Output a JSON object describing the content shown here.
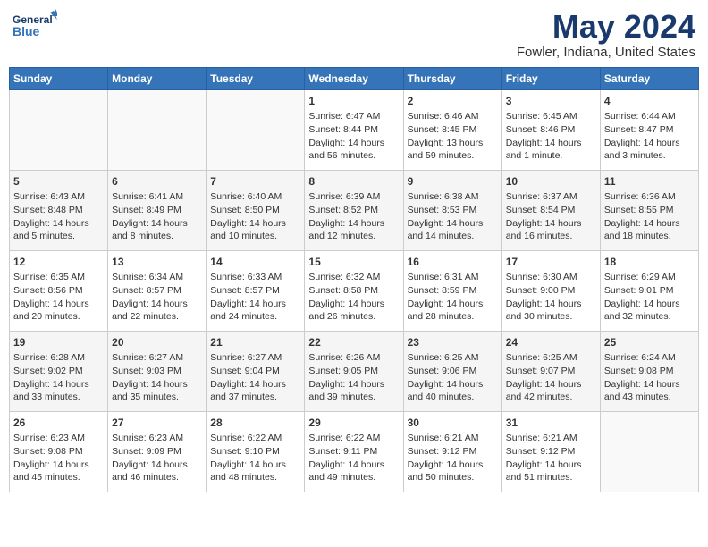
{
  "header": {
    "logo_line1": "General",
    "logo_line2": "Blue",
    "main_title": "May 2024",
    "subtitle": "Fowler, Indiana, United States"
  },
  "days_of_week": [
    "Sunday",
    "Monday",
    "Tuesday",
    "Wednesday",
    "Thursday",
    "Friday",
    "Saturday"
  ],
  "weeks": [
    [
      {
        "day": "",
        "content": ""
      },
      {
        "day": "",
        "content": ""
      },
      {
        "day": "",
        "content": ""
      },
      {
        "day": "1",
        "content": "Sunrise: 6:47 AM\nSunset: 8:44 PM\nDaylight: 14 hours\nand 56 minutes."
      },
      {
        "day": "2",
        "content": "Sunrise: 6:46 AM\nSunset: 8:45 PM\nDaylight: 13 hours\nand 59 minutes."
      },
      {
        "day": "3",
        "content": "Sunrise: 6:45 AM\nSunset: 8:46 PM\nDaylight: 14 hours\nand 1 minute."
      },
      {
        "day": "4",
        "content": "Sunrise: 6:44 AM\nSunset: 8:47 PM\nDaylight: 14 hours\nand 3 minutes."
      }
    ],
    [
      {
        "day": "5",
        "content": "Sunrise: 6:43 AM\nSunset: 8:48 PM\nDaylight: 14 hours\nand 5 minutes."
      },
      {
        "day": "6",
        "content": "Sunrise: 6:41 AM\nSunset: 8:49 PM\nDaylight: 14 hours\nand 8 minutes."
      },
      {
        "day": "7",
        "content": "Sunrise: 6:40 AM\nSunset: 8:50 PM\nDaylight: 14 hours\nand 10 minutes."
      },
      {
        "day": "8",
        "content": "Sunrise: 6:39 AM\nSunset: 8:52 PM\nDaylight: 14 hours\nand 12 minutes."
      },
      {
        "day": "9",
        "content": "Sunrise: 6:38 AM\nSunset: 8:53 PM\nDaylight: 14 hours\nand 14 minutes."
      },
      {
        "day": "10",
        "content": "Sunrise: 6:37 AM\nSunset: 8:54 PM\nDaylight: 14 hours\nand 16 minutes."
      },
      {
        "day": "11",
        "content": "Sunrise: 6:36 AM\nSunset: 8:55 PM\nDaylight: 14 hours\nand 18 minutes."
      }
    ],
    [
      {
        "day": "12",
        "content": "Sunrise: 6:35 AM\nSunset: 8:56 PM\nDaylight: 14 hours\nand 20 minutes."
      },
      {
        "day": "13",
        "content": "Sunrise: 6:34 AM\nSunset: 8:57 PM\nDaylight: 14 hours\nand 22 minutes."
      },
      {
        "day": "14",
        "content": "Sunrise: 6:33 AM\nSunset: 8:57 PM\nDaylight: 14 hours\nand 24 minutes."
      },
      {
        "day": "15",
        "content": "Sunrise: 6:32 AM\nSunset: 8:58 PM\nDaylight: 14 hours\nand 26 minutes."
      },
      {
        "day": "16",
        "content": "Sunrise: 6:31 AM\nSunset: 8:59 PM\nDaylight: 14 hours\nand 28 minutes."
      },
      {
        "day": "17",
        "content": "Sunrise: 6:30 AM\nSunset: 9:00 PM\nDaylight: 14 hours\nand 30 minutes."
      },
      {
        "day": "18",
        "content": "Sunrise: 6:29 AM\nSunset: 9:01 PM\nDaylight: 14 hours\nand 32 minutes."
      }
    ],
    [
      {
        "day": "19",
        "content": "Sunrise: 6:28 AM\nSunset: 9:02 PM\nDaylight: 14 hours\nand 33 minutes."
      },
      {
        "day": "20",
        "content": "Sunrise: 6:27 AM\nSunset: 9:03 PM\nDaylight: 14 hours\nand 35 minutes."
      },
      {
        "day": "21",
        "content": "Sunrise: 6:27 AM\nSunset: 9:04 PM\nDaylight: 14 hours\nand 37 minutes."
      },
      {
        "day": "22",
        "content": "Sunrise: 6:26 AM\nSunset: 9:05 PM\nDaylight: 14 hours\nand 39 minutes."
      },
      {
        "day": "23",
        "content": "Sunrise: 6:25 AM\nSunset: 9:06 PM\nDaylight: 14 hours\nand 40 minutes."
      },
      {
        "day": "24",
        "content": "Sunrise: 6:25 AM\nSunset: 9:07 PM\nDaylight: 14 hours\nand 42 minutes."
      },
      {
        "day": "25",
        "content": "Sunrise: 6:24 AM\nSunset: 9:08 PM\nDaylight: 14 hours\nand 43 minutes."
      }
    ],
    [
      {
        "day": "26",
        "content": "Sunrise: 6:23 AM\nSunset: 9:08 PM\nDaylight: 14 hours\nand 45 minutes."
      },
      {
        "day": "27",
        "content": "Sunrise: 6:23 AM\nSunset: 9:09 PM\nDaylight: 14 hours\nand 46 minutes."
      },
      {
        "day": "28",
        "content": "Sunrise: 6:22 AM\nSunset: 9:10 PM\nDaylight: 14 hours\nand 48 minutes."
      },
      {
        "day": "29",
        "content": "Sunrise: 6:22 AM\nSunset: 9:11 PM\nDaylight: 14 hours\nand 49 minutes."
      },
      {
        "day": "30",
        "content": "Sunrise: 6:21 AM\nSunset: 9:12 PM\nDaylight: 14 hours\nand 50 minutes."
      },
      {
        "day": "31",
        "content": "Sunrise: 6:21 AM\nSunset: 9:12 PM\nDaylight: 14 hours\nand 51 minutes."
      },
      {
        "day": "",
        "content": ""
      }
    ]
  ]
}
